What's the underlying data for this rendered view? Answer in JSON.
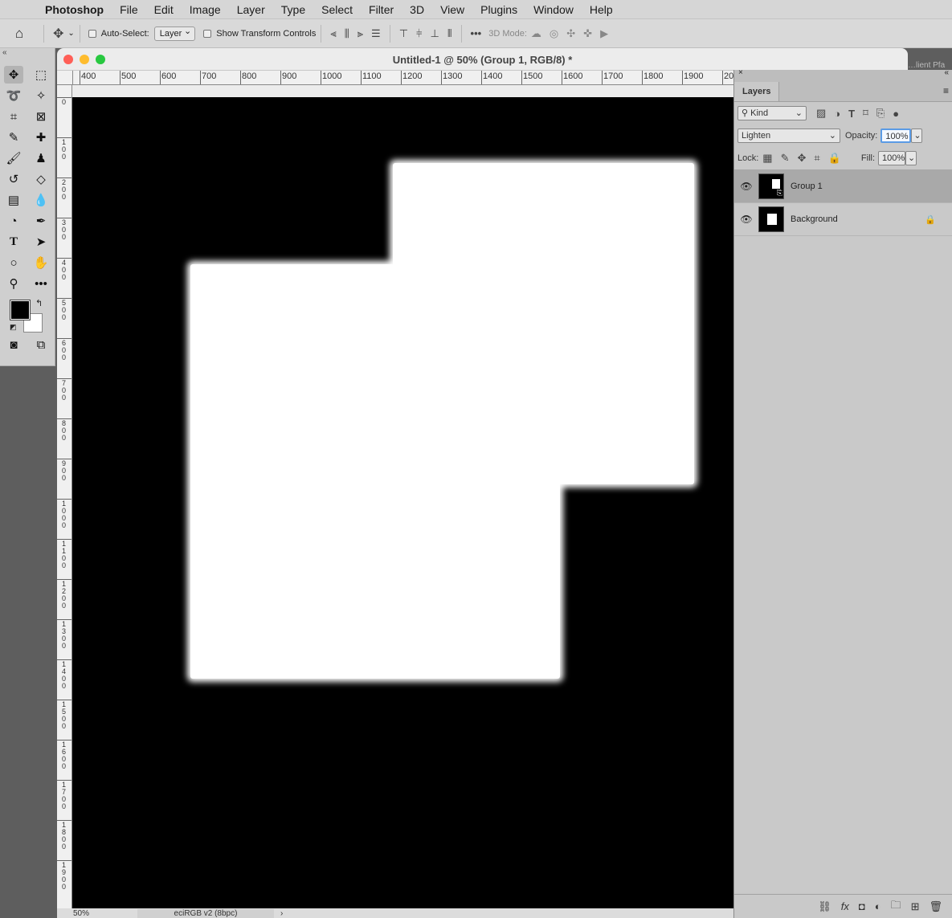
{
  "menu": {
    "apple": "",
    "app": "Photoshop",
    "items": [
      "File",
      "Edit",
      "Image",
      "Layer",
      "Type",
      "Select",
      "Filter",
      "3D",
      "View",
      "Plugins",
      "Window",
      "Help"
    ]
  },
  "options": {
    "auto_select_label": "Auto-Select:",
    "auto_select_value": "Layer",
    "transform_label": "Show Transform Controls",
    "mode3d_label": "3D Mode:"
  },
  "document": {
    "title": "Untitled-1 @ 50% (Group 1, RGB/8) *",
    "zoom": "50%",
    "profile": "eciRGB v2 (8bpc)",
    "canvas_color": "#000000",
    "shape_color": "#ffffff"
  },
  "rulers": {
    "h": [
      "400",
      "500",
      "600",
      "700",
      "800",
      "900",
      "1000",
      "1100",
      "1200",
      "1300",
      "1400",
      "1500",
      "1600",
      "1700",
      "1800",
      "1900",
      "20"
    ],
    "v": [
      "0",
      "100",
      "200",
      "300",
      "400",
      "500",
      "600",
      "700",
      "800",
      "900",
      "1000",
      "1100",
      "1200",
      "1300",
      "1400",
      "1500",
      "1600",
      "1700",
      "1800",
      "1900"
    ]
  },
  "panel": {
    "tab": "Layers",
    "filter_kind": "Kind",
    "blend_mode": "Lighten",
    "opacity_label": "Opacity:",
    "opacity": "100%",
    "lock_label": "Lock:",
    "fill_label": "Fill:",
    "fill": "100%",
    "layers": [
      {
        "name": "Group 1",
        "selected": true
      },
      {
        "name": "Background",
        "selected": false
      }
    ]
  },
  "peek_tabs": "…lient  Pfa",
  "colors": {
    "foreground": "#000000",
    "background": "#ffffff"
  }
}
